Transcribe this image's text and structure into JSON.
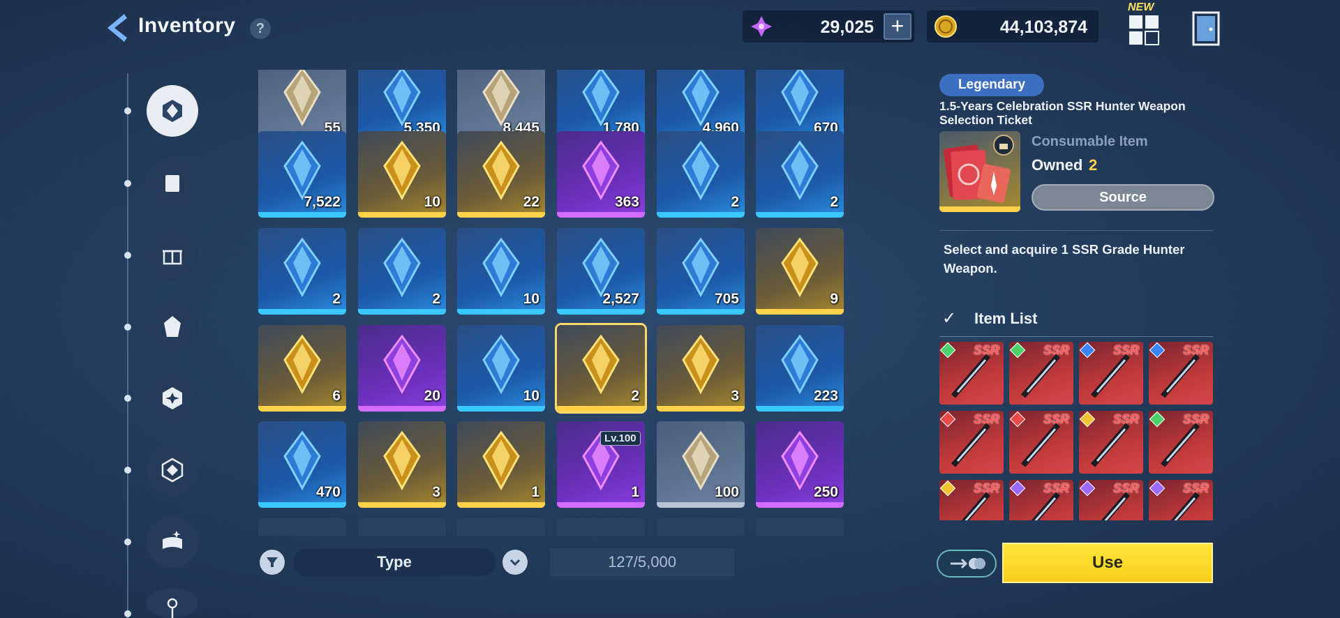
{
  "header": {
    "title": "Inventory",
    "help_label": "?",
    "currency_gems": "29,025",
    "currency_gold": "44,103,874",
    "plus_label": "+",
    "new_label": "NEW"
  },
  "sidebar": {
    "items": [
      {
        "icon": "equipment-icon",
        "active": true
      },
      {
        "icon": "material-icon"
      },
      {
        "icon": "gift-icon"
      },
      {
        "icon": "rune-icon"
      },
      {
        "icon": "emblem-icon"
      },
      {
        "icon": "crystal-icon"
      },
      {
        "icon": "book-icon"
      },
      {
        "icon": "key-icon"
      }
    ]
  },
  "inventory": {
    "rows": [
      [
        {
          "qty": "55",
          "rarity": "common",
          "icon": "document-icon"
        },
        {
          "qty": "5,350",
          "rarity": "rare",
          "icon": "purple-crate-icon"
        },
        {
          "qty": "8,445",
          "rarity": "common",
          "icon": "bronze-crate-icon"
        },
        {
          "qty": "1,780",
          "rarity": "rare",
          "icon": "yellow-crystal-pile-icon"
        },
        {
          "qty": "4,960",
          "rarity": "rare",
          "icon": "cyan-crystal-cluster-icon"
        },
        {
          "qty": "670",
          "rarity": "rare",
          "icon": "blue-crystal-cluster-icon"
        }
      ],
      [
        {
          "qty": "7,522",
          "rarity": "rare",
          "icon": "blue-crystal-icon"
        },
        {
          "qty": "10",
          "rarity": "legend",
          "icon": "silver-ticket-icon"
        },
        {
          "qty": "22",
          "rarity": "legend",
          "icon": "ssr-ticket-icon"
        },
        {
          "qty": "363",
          "rarity": "epic",
          "icon": "red-capsule-icon"
        },
        {
          "qty": "2",
          "rarity": "rare",
          "icon": "green-gem-icon"
        },
        {
          "qty": "2",
          "rarity": "rare",
          "icon": "cyan-gem-icon"
        }
      ],
      [
        {
          "qty": "2",
          "rarity": "rare",
          "icon": "red-crystal-icon"
        },
        {
          "qty": "2",
          "rarity": "rare",
          "icon": "violet-crystal-icon"
        },
        {
          "qty": "10",
          "rarity": "rare",
          "icon": "gold-crystal-icon"
        },
        {
          "qty": "2,527",
          "rarity": "rare",
          "icon": "pink-capsule-icon"
        },
        {
          "qty": "705",
          "rarity": "rare",
          "icon": "blue-capsule-icon"
        },
        {
          "qty": "9",
          "rarity": "legend",
          "icon": "gold-polyhedron-icon"
        }
      ],
      [
        {
          "qty": "6",
          "rarity": "legend",
          "icon": "silver-cube-icon"
        },
        {
          "qty": "20",
          "rarity": "epic",
          "icon": "purple-cube-icon"
        },
        {
          "qty": "10",
          "rarity": "rare",
          "icon": "pyramid-icon"
        },
        {
          "qty": "2",
          "rarity": "legend",
          "icon": "weapon-ticket-icon",
          "selected": true
        },
        {
          "qty": "3",
          "rarity": "legend",
          "icon": "green-hourglass-icon"
        },
        {
          "qty": "223",
          "rarity": "rare",
          "icon": "gold-hourglass-icon"
        }
      ],
      [
        {
          "qty": "470",
          "rarity": "rare",
          "icon": "teal-hourglass-icon"
        },
        {
          "qty": "3",
          "rarity": "legend",
          "icon": "prism-icon"
        },
        {
          "qty": "1",
          "rarity": "legend",
          "icon": "small-prism-icon"
        },
        {
          "qty": "1",
          "rarity": "epic",
          "icon": "scroll-icon",
          "badge": "Lv.100"
        },
        {
          "qty": "100",
          "rarity": "common",
          "icon": "armor-icon"
        },
        {
          "qty": "250",
          "rarity": "epic",
          "icon": "purple-lantern-icon"
        }
      ]
    ]
  },
  "bottom": {
    "type_label": "Type",
    "capacity": "127/5,000"
  },
  "detail": {
    "rarity": "Legendary",
    "name": "1.5-Years Celebration SSR Hunter Weapon Selection Ticket",
    "type": "Consumable Item",
    "owned_label": "Owned",
    "owned_value": "2",
    "source_label": "Source",
    "description": "Select and acquire 1 SSR Grade Hunter Weapon.",
    "list_title": "Item List",
    "list_items": [
      {
        "tag": "SSR",
        "element": "#4bd06a"
      },
      {
        "tag": "SSR",
        "element": "#4bd06a"
      },
      {
        "tag": "SSR",
        "element": "#3a84ff"
      },
      {
        "tag": "SSR",
        "element": "#3a84ff"
      },
      {
        "tag": "SSR",
        "element": "#e84a4a"
      },
      {
        "tag": "SSR",
        "element": "#e84a4a"
      },
      {
        "tag": "SSR",
        "element": "#f1c232"
      },
      {
        "tag": "SSR",
        "element": "#4bd06a"
      },
      {
        "tag": "SSR",
        "element": "#f1c232"
      },
      {
        "tag": "SSR",
        "element": "#9b6bff"
      },
      {
        "tag": "SSR",
        "element": "#9b6bff"
      },
      {
        "tag": "SSR",
        "element": "#9b6bff"
      }
    ],
    "use_label": "Use"
  },
  "colors": {
    "rare": "#1b58a8",
    "epic": "#6a2fb9",
    "legend": "#a88a2e",
    "accent_yellow": "#ffd24a"
  }
}
